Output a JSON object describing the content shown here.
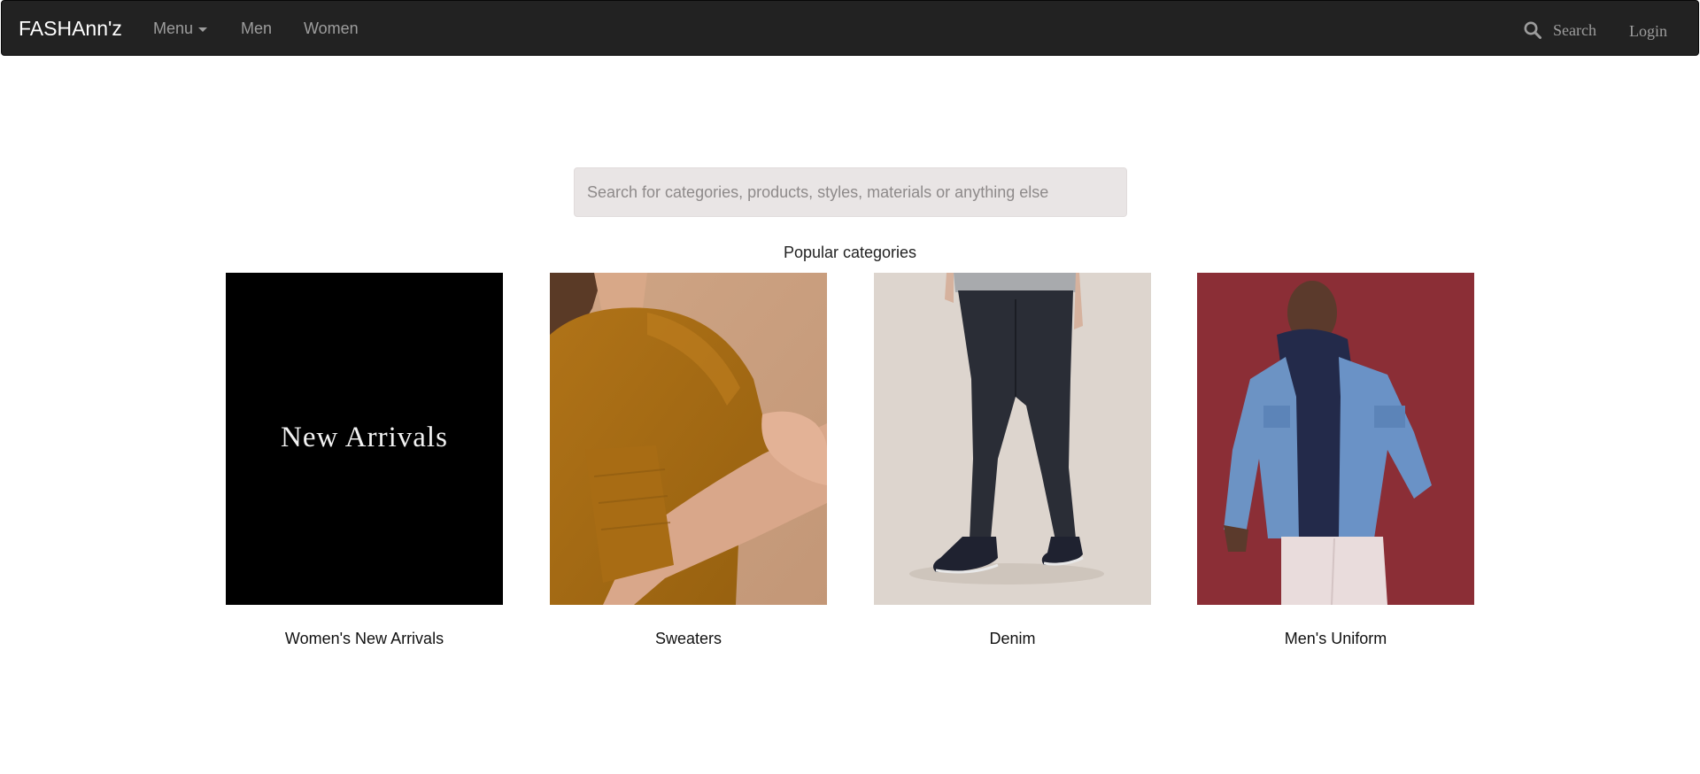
{
  "navbar": {
    "brand": "FASHAnn'z",
    "menu_label": "Menu",
    "men_label": "Men",
    "women_label": "Women",
    "search_label": "Search",
    "login_label": "Login",
    "search_icon": "search-icon",
    "background_color": "#222222",
    "link_color": "#9d9d9d"
  },
  "search": {
    "placeholder": "Search for categories, products, styles, materials or anything else",
    "value": ""
  },
  "categories": {
    "heading": "Popular categories",
    "items": [
      {
        "caption": "Women's New Arrivals",
        "image_text": "New Arrivals",
        "image_bg": "#000000"
      },
      {
        "caption": "Sweaters",
        "image_bg": "#c9a07f"
      },
      {
        "caption": "Denim",
        "image_bg": "#ddd5ce"
      },
      {
        "caption": "Men's Uniform",
        "image_bg": "#8b2e36"
      }
    ]
  }
}
